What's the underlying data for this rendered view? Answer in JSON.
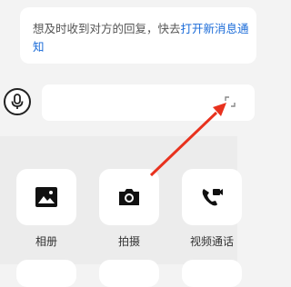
{
  "notice": {
    "text": "想及时收到对方的回复，快去",
    "link": "打开新消息通",
    "text2": "知"
  },
  "input": {
    "placeholder": ""
  },
  "actions": [
    {
      "label": "相册",
      "icon": "image-icon"
    },
    {
      "label": "拍摄",
      "icon": "camera-icon"
    },
    {
      "label": "视频通话",
      "icon": "video-call-icon"
    }
  ],
  "colors": {
    "link": "#1a6bd8",
    "arrow": "#e8321e",
    "panel": "#ececec"
  }
}
